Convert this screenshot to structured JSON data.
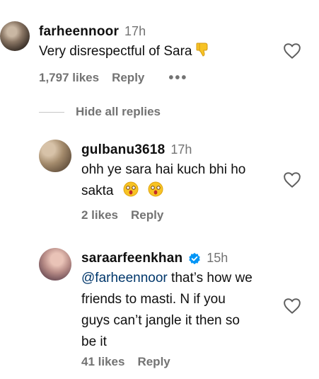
{
  "comments": [
    {
      "username": "farheennoor",
      "time": "17h",
      "text": "Very disrespectful of Sara",
      "emoji_icons": [
        "thumbs-down-icon"
      ],
      "likes": "1,797 likes",
      "reply": "Reply",
      "more": "•••"
    },
    {
      "username": "gulbanu3618",
      "time": "17h",
      "text_line1": "ohh ye sara hai kuch bhi ho",
      "text_line2": "sakta",
      "emoji_icons": [
        "astonished-face-icon",
        "astonished-face-icon"
      ],
      "likes": "2 likes",
      "reply": "Reply"
    },
    {
      "username": "saraarfeenkhan",
      "verified": true,
      "time": "15h",
      "mention": "@farheennoor",
      "text_line1": " that’s how we",
      "text_line2": "friends to masti. N if you",
      "text_line3": "guys can’t jangle it then so",
      "text_line4": "be it",
      "likes": "41 likes",
      "reply": "Reply"
    }
  ],
  "hide_replies": "Hide all replies",
  "colors": {
    "text": "#0f0f0f",
    "muted": "#737373",
    "mention": "#00376b",
    "verified": "#0095f6"
  }
}
